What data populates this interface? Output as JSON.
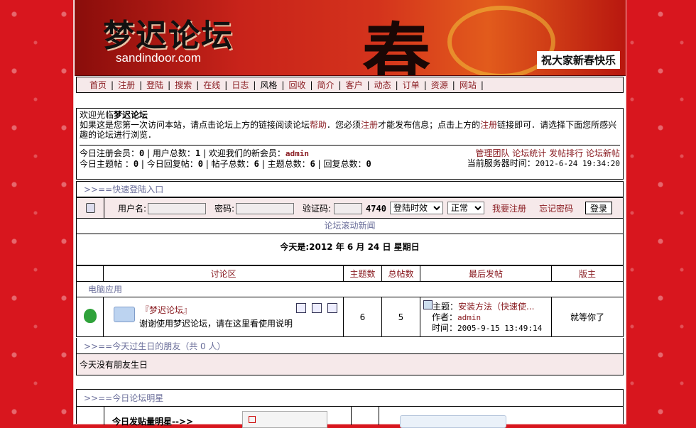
{
  "banner": {
    "logo_text": "梦迟论坛",
    "site_url": "sandindoor.com",
    "big_char": "春",
    "greeting": "祝大家新春快乐"
  },
  "nav": [
    "首页",
    "注册",
    "登陆",
    "搜索",
    "在线",
    "日志",
    "风格",
    "回收",
    "简介",
    "客户",
    "动态",
    "订单",
    "资源",
    "网站"
  ],
  "welcome": {
    "prefix": "欢迎光临",
    "forum_name": "梦迟论坛",
    "line1_a": "如果这是您第一次访问本站，请点击论坛上方的链接阅读论坛",
    "help_link": "帮助",
    "line1_b": "．您必须",
    "register_link": "注册",
    "line1_c": "才能发布信息；点击上方的",
    "register_link2": "注册",
    "line1_d": "链接即可．请选择下面您所感兴趣的论坛进行浏览．"
  },
  "stats": {
    "today_reg_label": "今日注册会员：",
    "today_reg": "0",
    "users_label": "用户总数：",
    "users": "1",
    "welcome_new": "欢迎我们的新会员：",
    "new_member": "admin",
    "today_topics_label": "今日主题帖  ：",
    "today_topics": "0",
    "today_replies_label": "今日回复帖：",
    "today_replies": "0",
    "posts_label": "帖子总数：",
    "posts": "6",
    "topics_label": "主题总数：",
    "topics": "6",
    "replies_label": "回复总数：",
    "replies": "0",
    "links": [
      "管理团队",
      "论坛统计",
      "发帖排行",
      "论坛新帖"
    ],
    "server_time_label": "当前服务器时间：",
    "server_time": "2012-6-24 19:34:20"
  },
  "quick_login": {
    "title": ">>==快速登陆入口",
    "username_label": "用户名:",
    "password_label": "密码:",
    "captcha_label": "验证码:",
    "captcha_code": "4740",
    "duration_option": "登陆时效",
    "mode_option": "正常",
    "register_link": "我要注册",
    "forgot_link": "忘记密码",
    "login_button": "登录"
  },
  "news_title": "论坛滚动新闻",
  "today_line": "今天是:2012 年 6 月 24 日 星期日",
  "forum_table": {
    "headers": [
      "讨论区",
      "主题数",
      "总帖数",
      "最后发帖",
      "版主"
    ],
    "category": "电脑应用",
    "forum_name": "『梦迟论坛』",
    "forum_desc": "谢谢使用梦迟论坛，请在这里看使用说明",
    "topics": "6",
    "posts": "5",
    "last_topic_label": "主题：",
    "last_topic": "安装方法（快速使...",
    "author_label": "作者：",
    "author": "admin",
    "time_label": "时间：",
    "time": "2005-9-15 13:49:14",
    "moderator": "就等你了"
  },
  "birthday": {
    "title": ">>==今天过生日的朋友",
    "count_text": "（共 0 人）",
    "none_text": "今天没有朋友生日"
  },
  "stars": {
    "title": ">>==今日论坛明星",
    "label": "今日发贴量明星-->>"
  }
}
